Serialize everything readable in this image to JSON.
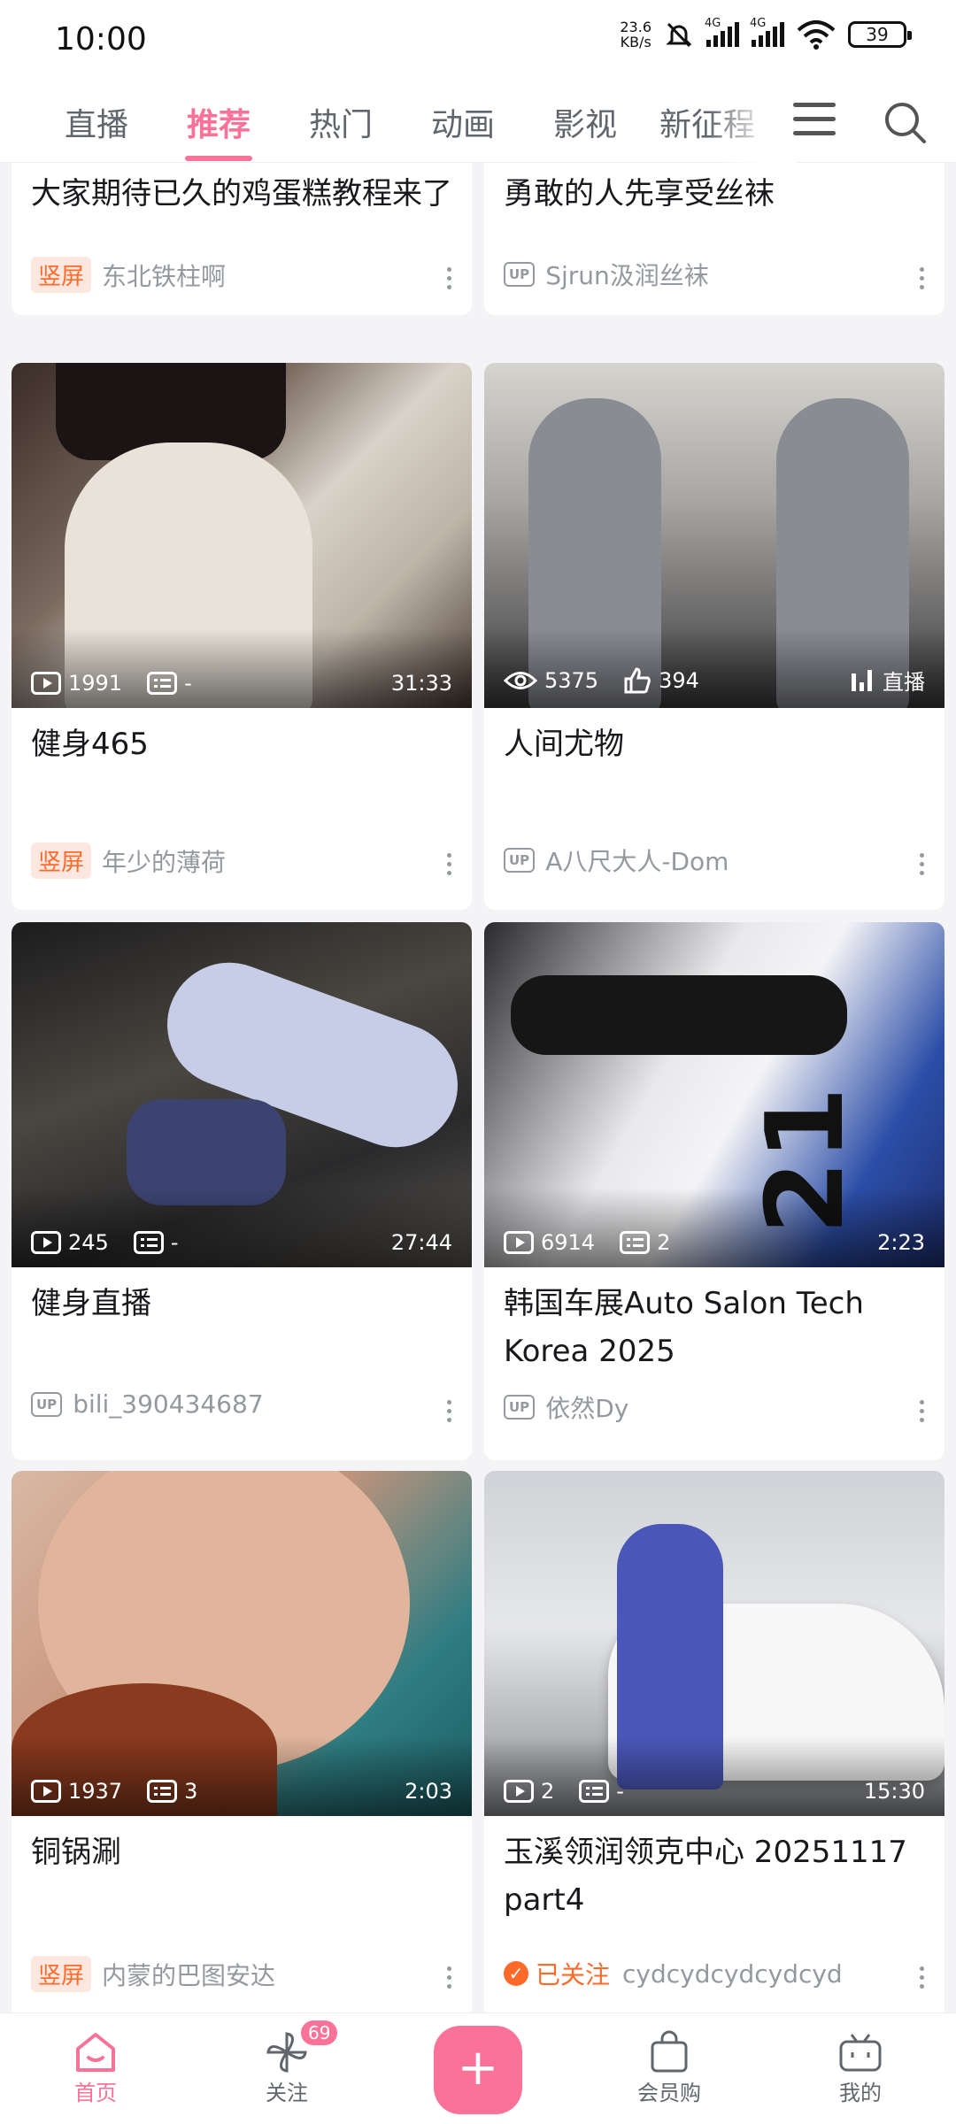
{
  "status": {
    "time": "10:00",
    "speed_value": "23.6",
    "speed_unit": "KB/s",
    "net1": "4G",
    "net2": "4G",
    "battery": "39"
  },
  "nav": {
    "tabs": [
      "直播",
      "推荐",
      "热门",
      "动画",
      "影视",
      "新征程"
    ],
    "active": "推荐"
  },
  "cards": [
    {
      "title": "大家期待已久的鸡蛋糕教程来了",
      "badge": "竖屏",
      "author": "东北铁柱啊"
    },
    {
      "title": "勇敢的人先享受丝袜",
      "badge": "UP",
      "author": "Sjrun汲润丝袜"
    },
    {
      "title": "健身465",
      "badge": "竖屏",
      "author": "年少的薄荷",
      "plays": "1991",
      "danmu": "-",
      "duration": "31:33"
    },
    {
      "title": "人间尤物",
      "badge": "UP",
      "author": "A八尺大人-Dom",
      "views": "5375",
      "likes": "394",
      "live_label": "直播"
    },
    {
      "title": "健身直播",
      "badge": "UP",
      "author": "bili_390434687",
      "plays": "245",
      "danmu": "-",
      "duration": "27:44"
    },
    {
      "title": "韩国车展Auto Salon Tech Korea 2025",
      "badge": "UP",
      "author": "依然Dy",
      "plays": "6914",
      "danmu": "2",
      "duration": "2:23",
      "thumb_number": "21"
    },
    {
      "title": "铜锅涮",
      "badge": "竖屏",
      "author": "内蒙的巴图安达",
      "plays": "1937",
      "danmu": "3",
      "duration": "2:03"
    },
    {
      "title": "玉溪领润领克中心 20251117 part4",
      "badge": "已关注",
      "author": "cydcydcydcydcyd",
      "plays": "2",
      "danmu": "-",
      "duration": "15:30"
    }
  ],
  "bottom": {
    "home": "首页",
    "follow": "关注",
    "follow_count": "69",
    "plus": "+",
    "vip": "会员购",
    "mine": "我的"
  }
}
